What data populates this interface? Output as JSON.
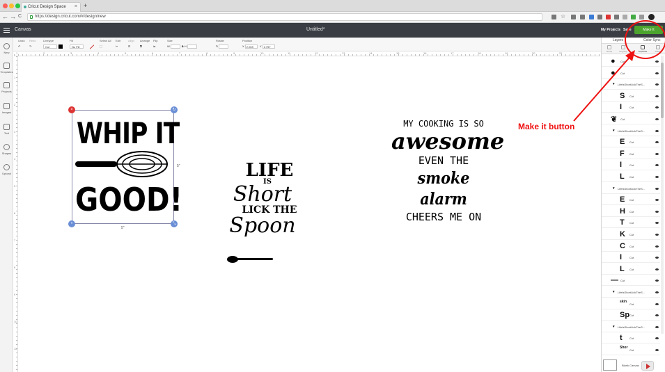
{
  "browser": {
    "tab_title": "Cricut Design Space",
    "new_tab": "+",
    "url": "https://design.cricut.com/#/design/new",
    "nav_back": "←",
    "nav_forward": "→",
    "nav_reload": "C",
    "traffic_colors": [
      "#fc5f57",
      "#fdbc2e",
      "#28c840"
    ]
  },
  "header": {
    "canvas_label": "Canvas",
    "project_title": "Untitled*",
    "my_projects": "My Projects",
    "save": "Save",
    "make_it": "Make It",
    "accent": "#4ca42e"
  },
  "toolbar": {
    "undo": "Undo",
    "redo": "Redo",
    "linetype": "Linetype",
    "linetype_value": "Cut",
    "fill": "Fill",
    "fill_value": "No Fill",
    "select_all": "Select All",
    "edit": "Edit",
    "align": "Align",
    "arrange": "Arrange",
    "flip": "Flip",
    "size": "Size",
    "size_w": "W",
    "size_h": "H",
    "rotate": "Rotate",
    "position": "Position",
    "pos_x": "X",
    "pos_x_value": "2.069",
    "pos_y": "Y",
    "pos_y_value": "2.757"
  },
  "sidebar": [
    {
      "label": "New",
      "icon": "plus-icon"
    },
    {
      "label": "Templates",
      "icon": "shirt-icon"
    },
    {
      "label": "Projects",
      "icon": "projects-icon"
    },
    {
      "label": "Images",
      "icon": "image-icon"
    },
    {
      "label": "Text",
      "icon": "text-icon"
    },
    {
      "label": "Shapes",
      "icon": "shapes-icon"
    },
    {
      "label": "Upload",
      "icon": "upload-icon"
    }
  ],
  "rulers": {
    "top": [
      "1",
      "2",
      "3",
      "4",
      "5",
      "6",
      "7",
      "8",
      "9",
      "10",
      "11",
      "12",
      "13",
      "14",
      "15",
      "16",
      "17",
      "18",
      "19",
      "20",
      "21"
    ],
    "left": [
      "1",
      "2",
      "3",
      "4",
      "5",
      "6",
      "7",
      "8",
      "9",
      "10",
      "11"
    ]
  },
  "designs": {
    "whip": {
      "line1": "WHIP IT",
      "line2": "GOOD!",
      "width_dim": "5\"",
      "height_dim": "5\""
    },
    "life": {
      "line1": "LIFE",
      "line2": "IS",
      "line3": "Short",
      "line4": "LICK THE",
      "line5": "Spoon"
    },
    "cooking": {
      "line1": "MY COOKING IS SO",
      "line2": "awesome",
      "line3": "EVEN THE",
      "line4": "smoke alarm",
      "line5": "CHEERS ME ON"
    }
  },
  "panel": {
    "tab_layers": "Layers",
    "tab_color_sync": "Color Sync",
    "tools": [
      "Group",
      "Ungroup",
      "Duplicate",
      "Delete"
    ],
    "layers": [
      {
        "glyph": "●",
        "label": "Cut",
        "indent": 0
      },
      {
        "glyph": "●",
        "label": "Cut",
        "indent": 0
      },
      {
        "glyph": "▾",
        "label": "LifeIsShortLickTheS...",
        "indent": 0
      },
      {
        "glyph": "S",
        "label": "Cut",
        "indent": 1
      },
      {
        "glyph": "I",
        "label": "Cut",
        "indent": 1
      },
      {
        "glyph": "❦",
        "label": "Cut",
        "indent": 0
      },
      {
        "glyph": "▾",
        "label": "LifeIsShortLickTheS...",
        "indent": 0
      },
      {
        "glyph": "E",
        "label": "Cut",
        "indent": 1
      },
      {
        "glyph": "F",
        "label": "Cut",
        "indent": 1
      },
      {
        "glyph": "I",
        "label": "Cut",
        "indent": 1
      },
      {
        "glyph": "L",
        "label": "Cut",
        "indent": 1
      },
      {
        "glyph": "▾",
        "label": "LifeIsShortLickTheS...",
        "indent": 0
      },
      {
        "glyph": "E",
        "label": "Cut",
        "indent": 1
      },
      {
        "glyph": "H",
        "label": "Cut",
        "indent": 1
      },
      {
        "glyph": "T",
        "label": "Cut",
        "indent": 1
      },
      {
        "glyph": "K",
        "label": "Cut",
        "indent": 1
      },
      {
        "glyph": "C",
        "label": "Cut",
        "indent": 1
      },
      {
        "glyph": "I",
        "label": "Cut",
        "indent": 1
      },
      {
        "glyph": "L",
        "label": "Cut",
        "indent": 1
      },
      {
        "glyph": "—",
        "label": "Cut",
        "indent": 0
      },
      {
        "glyph": "▾",
        "label": "LifeIsShortLickTheS...",
        "indent": 0
      },
      {
        "glyph": "skin",
        "label": "Cut",
        "indent": 1
      },
      {
        "glyph": "Sp",
        "label": "Cut",
        "indent": 1
      },
      {
        "glyph": "▾",
        "label": "LifeIsShortLickTheS...",
        "indent": 0
      },
      {
        "glyph": "t",
        "label": "Cut",
        "indent": 1
      },
      {
        "glyph": "Shor",
        "label": "Cut",
        "indent": 1
      }
    ],
    "blank_canvas": "Blank Canvas"
  },
  "annotation": {
    "text": "Make it button",
    "color": "#e11111"
  }
}
